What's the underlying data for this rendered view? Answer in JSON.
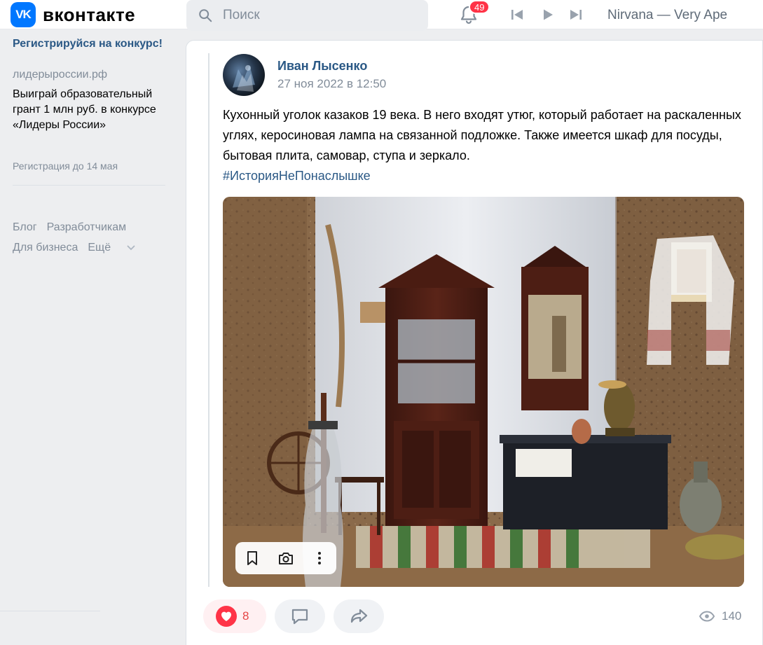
{
  "header": {
    "logo_badge": "VK",
    "logo_text": "вконтакте",
    "search_placeholder": "Поиск",
    "notifications_count": "49",
    "now_playing": "Nirvana — Very Ape"
  },
  "sidebar": {
    "ad_title": "Регистрируйся на конкурс!",
    "ad_domain": "лидерыроссии.рф",
    "ad_text": "Выиграй образовательный грант 1 млн руб. в конкурсе «Лидеры России»",
    "ad_note": "Регистрация до 14 мая",
    "footer_links": [
      "Блог",
      "Разработчикам",
      "Для бизнеса",
      "Ещё"
    ]
  },
  "post": {
    "author": "Иван Лысенко",
    "date": "27 ноя 2022 в 12:50",
    "text": "Кухонный уголок казаков 19 века. В него входят утюг, который работает на раскаленных углях, керосиновая лампа на связанной подложке. Также имеется шкаф для посуды, бытовая плита, самовар, ступа и зеркало.",
    "hashtag": "#ИсторияНеПонаслышке",
    "likes": "8",
    "views": "140"
  },
  "icons": {
    "search": "search-icon",
    "bell": "bell-icon",
    "prev": "previous-track-icon",
    "play": "play-icon",
    "next": "next-track-icon",
    "bookmark": "bookmark-icon",
    "camera": "camera-icon",
    "more": "more-icon",
    "heart": "heart-icon",
    "comment": "comment-icon",
    "share": "share-icon",
    "eye": "eye-icon"
  },
  "colors": {
    "brand": "#0077ff",
    "link": "#2a5885",
    "badge": "#ff3347",
    "like": "#e64646"
  }
}
